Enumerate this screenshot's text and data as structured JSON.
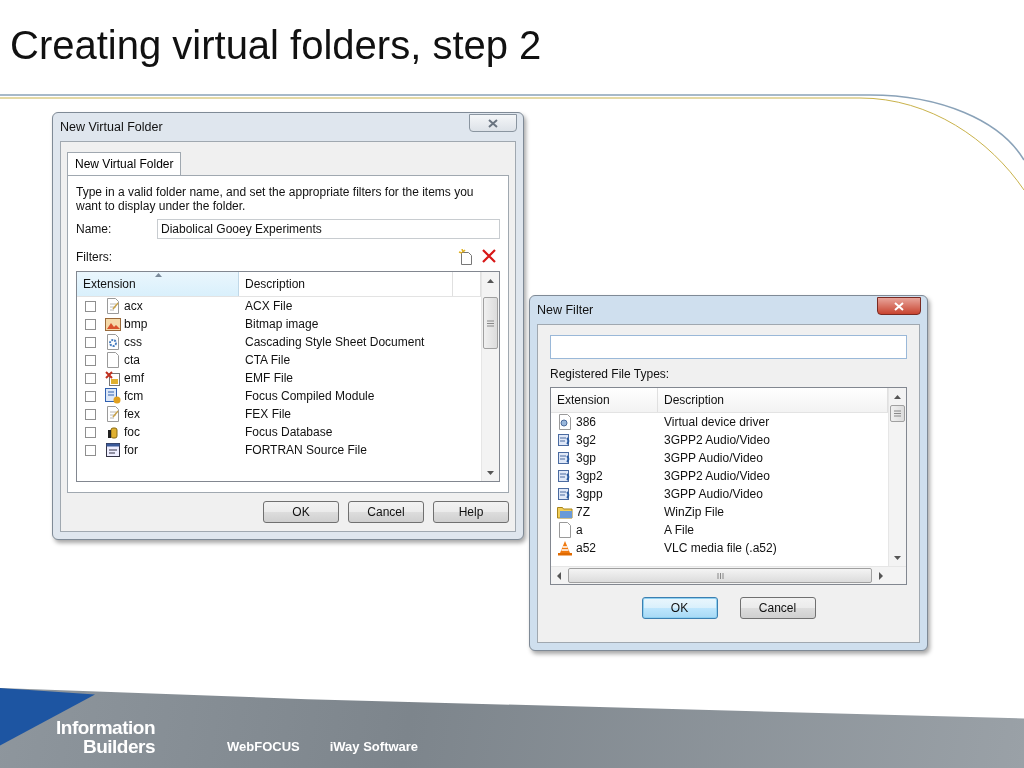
{
  "slide": {
    "title": "Creating virtual folders, step 2"
  },
  "virtual_folder_dialog": {
    "title": "New Virtual Folder",
    "active": false,
    "tabs": [
      {
        "label": "New Virtual Folder",
        "selected": true
      }
    ],
    "instructions": "Type in a valid folder name, and set the appropriate filters for the items you want to display under the folder.",
    "name_label": "Name:",
    "name_value": "Diabolical Gooey Experiments",
    "filters_label": "Filters:",
    "columns": [
      "Extension",
      "Description"
    ],
    "rows": [
      {
        "kind": "document",
        "extension": "acx",
        "description": "ACX File",
        "checked": false
      },
      {
        "kind": "image",
        "extension": "bmp",
        "description": "Bitmap image",
        "checked": false
      },
      {
        "kind": "gear",
        "extension": "css",
        "description": "Cascading Style Sheet Document",
        "checked": false
      },
      {
        "kind": "blank",
        "extension": "cta",
        "description": "CTA File",
        "checked": false
      },
      {
        "kind": "picture",
        "extension": "emf",
        "description": "EMF File",
        "checked": false
      },
      {
        "kind": "program",
        "extension": "fcm",
        "description": "Focus Compiled Module",
        "checked": false
      },
      {
        "kind": "document",
        "extension": "fex",
        "description": "FEX File",
        "checked": false
      },
      {
        "kind": "database",
        "extension": "foc",
        "description": "Focus Database",
        "checked": false
      },
      {
        "kind": "code",
        "extension": "for",
        "description": "FORTRAN Source File",
        "checked": false
      }
    ],
    "buttons": [
      {
        "label": "OK",
        "default": false
      },
      {
        "label": "Cancel",
        "default": false
      },
      {
        "label": "Help",
        "default": false
      }
    ]
  },
  "filter_dialog": {
    "title": "New Filter",
    "active": true,
    "list_label": "Registered File Types:",
    "columns": [
      "Extension",
      "Description"
    ],
    "rows": [
      {
        "kind": "driver",
        "extension": "386",
        "description": "Virtual device driver"
      },
      {
        "kind": "media",
        "extension": "3g2",
        "description": "3GPP2 Audio/Video"
      },
      {
        "kind": "media",
        "extension": "3gp",
        "description": "3GPP Audio/Video"
      },
      {
        "kind": "media",
        "extension": "3gp2",
        "description": "3GPP2 Audio/Video"
      },
      {
        "kind": "media",
        "extension": "3gpp",
        "description": "3GPP Audio/Video"
      },
      {
        "kind": "folder",
        "extension": "7Z",
        "description": "WinZip File"
      },
      {
        "kind": "blank",
        "extension": "a",
        "description": "A File"
      },
      {
        "kind": "cone",
        "extension": "a52",
        "description": "VLC media file (.a52)"
      }
    ],
    "buttons": [
      {
        "label": "OK",
        "default": true
      },
      {
        "label": "Cancel",
        "default": false
      }
    ]
  },
  "footer": {
    "logo_lines": [
      "Information",
      "Builders"
    ],
    "links": [
      "WebFOCUS",
      "iWay Software"
    ]
  }
}
